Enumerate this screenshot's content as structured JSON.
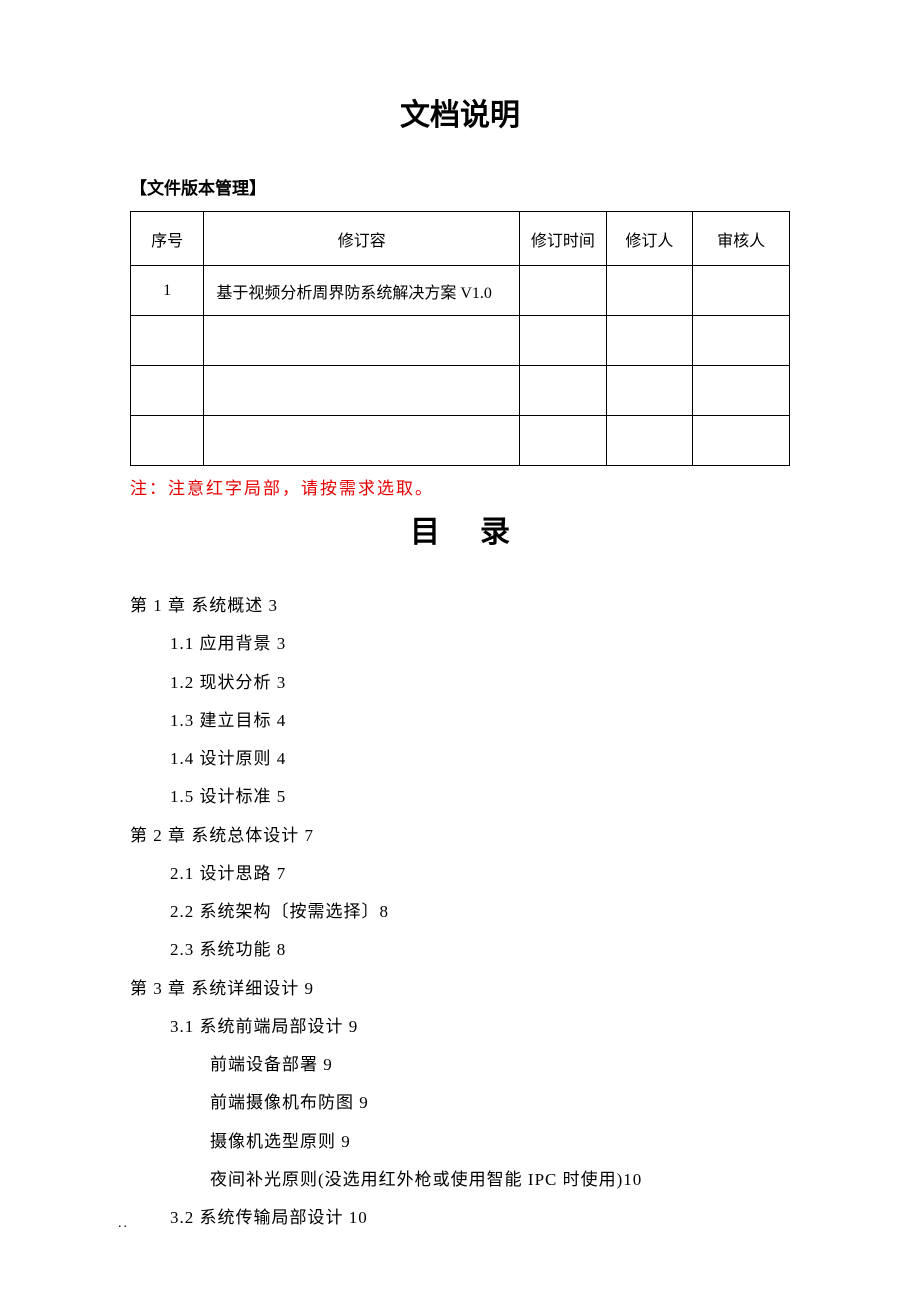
{
  "title": "文档说明",
  "section_label": "【文件版本管理】",
  "table": {
    "headers": [
      "序号",
      "修订容",
      "修订时间",
      "修订人",
      "审核人"
    ],
    "rows": [
      {
        "seq": "1",
        "content": "基于视频分析周界防系统解决方案 V1.0",
        "time": "",
        "editor": "",
        "reviewer": ""
      },
      {
        "seq": "",
        "content": "",
        "time": "",
        "editor": "",
        "reviewer": ""
      },
      {
        "seq": "",
        "content": "",
        "time": "",
        "editor": "",
        "reviewer": ""
      },
      {
        "seq": "",
        "content": "",
        "time": "",
        "editor": "",
        "reviewer": ""
      }
    ]
  },
  "note": "注：注意红字局部，请按需求选取。",
  "toc_title": "目录",
  "toc": [
    {
      "level": 1,
      "text": "第 1 章 系统概述 3"
    },
    {
      "level": 2,
      "text": "1.1 应用背景 3"
    },
    {
      "level": 2,
      "text": "1.2 现状分析 3"
    },
    {
      "level": 2,
      "text": "1.3 建立目标 4"
    },
    {
      "level": 2,
      "text": "1.4 设计原则 4"
    },
    {
      "level": 2,
      "text": "1.5 设计标准 5"
    },
    {
      "level": 1,
      "text": "第 2 章 系统总体设计 7"
    },
    {
      "level": 2,
      "text": "2.1 设计思路 7"
    },
    {
      "level": 2,
      "text": "2.2 系统架构〔按需选择〕8"
    },
    {
      "level": 2,
      "text": "2.3 系统功能 8"
    },
    {
      "level": 1,
      "text": "第 3 章 系统详细设计 9"
    },
    {
      "level": 2,
      "text": "3.1 系统前端局部设计 9"
    },
    {
      "level": 3,
      "text": "前端设备部署 9"
    },
    {
      "level": 3,
      "text": "前端摄像机布防图 9"
    },
    {
      "level": 3,
      "text": "摄像机选型原则 9"
    },
    {
      "level": 3,
      "text": "夜间补光原则(没选用红外枪或使用智能 IPC 时使用)10"
    },
    {
      "level": 2,
      "text": "3.2 系统传输局部设计 10"
    }
  ],
  "footer": ".."
}
